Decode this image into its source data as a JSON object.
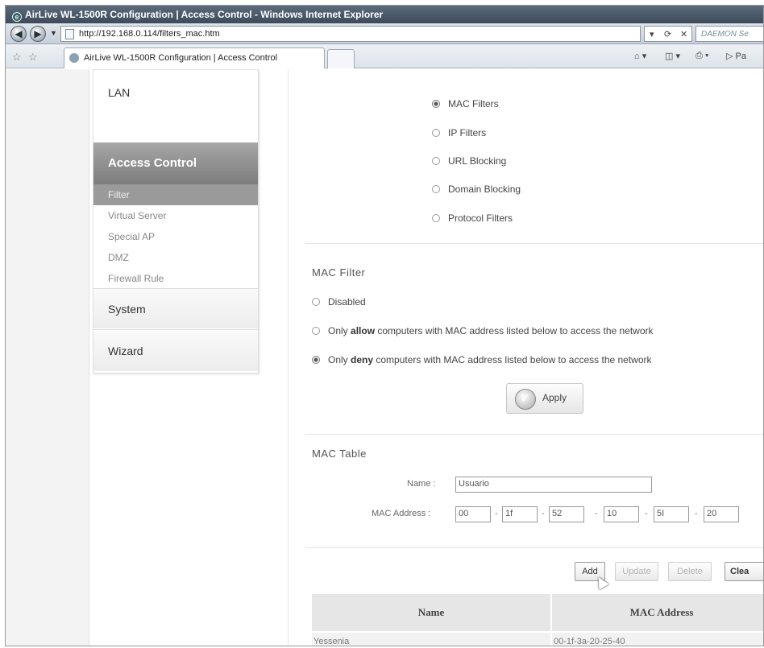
{
  "window": {
    "title": "AirLive WL-1500R Configuration | Access Control - Windows Internet Explorer"
  },
  "addressbar": {
    "url": "http://192.168.0.114/filters_mac.htm",
    "search_placeholder": "DAEMON Se"
  },
  "tabs": {
    "active_label": "AirLive WL-1500R Configuration | Access Control"
  },
  "commandbar": {
    "page_label": "Pa"
  },
  "sidebar": {
    "lan": "LAN",
    "access_control": "Access Control",
    "sub_items": [
      "Filter",
      "Virtual Server",
      "Special AP",
      "DMZ",
      "Firewall Rule"
    ],
    "system": "System",
    "wizard": "Wizard"
  },
  "filter_types": {
    "selected": "MAC Filters",
    "options": [
      "MAC Filters",
      "IP Filters",
      "URL Blocking",
      "Domain Blocking",
      "Protocol Filters"
    ]
  },
  "mac_filter": {
    "title": "MAC Filter",
    "selected_mode": "deny",
    "disabled_label": "Disabled",
    "allow": {
      "prefix": "Only ",
      "keyword": "allow",
      "suffix": " computers with MAC address listed below to access the network"
    },
    "deny": {
      "prefix": "Only ",
      "keyword": "deny",
      "suffix": " computers with MAC address listed below to access the network"
    },
    "apply_label": "Apply"
  },
  "mac_table": {
    "title": "MAC Table",
    "name_label": "Name :",
    "name_value": "Usuario",
    "mac_label": "MAC Address :",
    "mac_octets": [
      "00",
      "1f",
      "52",
      "10",
      "5I",
      "20"
    ],
    "buttons": {
      "add": "Add",
      "update": "Update",
      "delete": "Delete",
      "clear": "Clea"
    },
    "columns": [
      "Name",
      "MAC Address"
    ],
    "rows": [
      {
        "name": "Yessenia",
        "mac": "00-1f-3a-20-25-40"
      }
    ]
  }
}
